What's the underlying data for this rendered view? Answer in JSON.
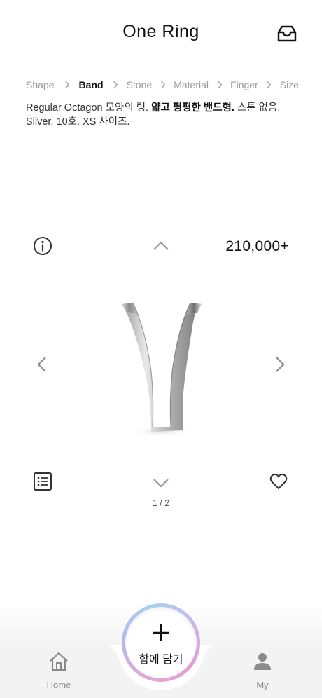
{
  "header": {
    "title": "One Ring",
    "inbox_icon": "inbox-icon"
  },
  "steps": [
    {
      "label": "Shape",
      "active": false
    },
    {
      "label": "Band",
      "active": true
    },
    {
      "label": "Stone",
      "active": false
    },
    {
      "label": "Material",
      "active": false
    },
    {
      "label": "Finger",
      "active": false
    },
    {
      "label": "Size",
      "active": false
    }
  ],
  "description": {
    "part1": "Regular Octagon 모양의 링. ",
    "bold": "얇고 평평한 밴드형.",
    "part2": " 스톤 없음.",
    "line2": "Silver. 10호. XS 사이즈."
  },
  "viewer": {
    "price": "210,000+",
    "page_indicator": "1 / 2"
  },
  "add_button": {
    "label": "함에 담기"
  },
  "bottom_nav": {
    "home": "Home",
    "my": "My"
  },
  "colors": {
    "active": "#111111",
    "inactive": "#9a9a9a",
    "gradient_pink": "#e39ccf",
    "gradient_blue": "#a7d0ef"
  }
}
